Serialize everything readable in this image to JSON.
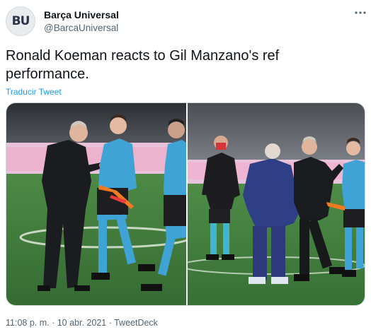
{
  "account": {
    "avatar_text": "BU",
    "name": "Barça Universal",
    "handle": "@BarcaUniversal"
  },
  "tweet": {
    "text": "Ronald Koeman reacts to Gil Manzano's ref performance.",
    "translate_link": "Traducir Tweet"
  },
  "meta": {
    "time_line": "11:08 p. m. · 10 abr. 2021 · TweetDeck"
  },
  "icons": {
    "more": "more-dots-icon"
  },
  "colors": {
    "link": "#1d9bf0",
    "secondary_text": "#536471",
    "pitch": "#3f7a3c",
    "referee_shirt": "#3fa3d6"
  }
}
